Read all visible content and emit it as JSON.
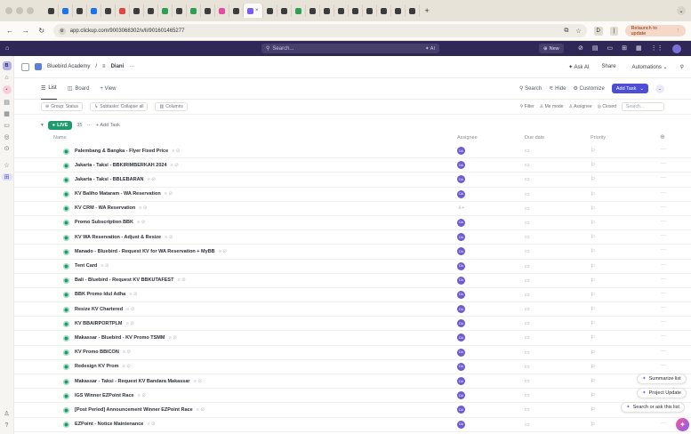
{
  "browser": {
    "tab_count": 26,
    "active_tab_close": "×",
    "new_tab": "+",
    "url": "app.clickup.com/9003068302/v/li/901601465277",
    "relaunch_label": "Relaunch to update"
  },
  "cu_header": {
    "search_placeholder": "Search...",
    "ai_label": "AI",
    "new_label": "New"
  },
  "breadcrumb": {
    "workspace": "Bluebird Academy",
    "separator": "/",
    "list": "Diani",
    "more": "···",
    "ask_ai": "Ask AI",
    "share": "Share",
    "automations": "Automations"
  },
  "views": {
    "list": "List",
    "board": "Board",
    "add_view": "+ View",
    "search": "Search",
    "hide": "Hide",
    "customize": "Customize",
    "add_task": "Add Task"
  },
  "filters": {
    "group": "Group: Status",
    "subtasks": "Subtasks: Collapse all",
    "columns": "Columns",
    "filter": "Filter",
    "me_mode": "Me mode",
    "assignee": "Assignee",
    "closed": "Closed",
    "search_placeholder": "Search..."
  },
  "group": {
    "status": "LIVE",
    "count": "35",
    "more": "···",
    "add_task": "+ Add Task"
  },
  "columns": {
    "name": "Name",
    "assignee": "Assignee",
    "due_date": "Due date",
    "priority": "Priority"
  },
  "tasks": [
    {
      "name": "Palembang & Bangka - Flyer Fixed Price",
      "assignee": "DA"
    },
    {
      "name": "Jakarta - Taksi - BBKIRIMBERKAH 2024",
      "assignee": "DA"
    },
    {
      "name": "Jakarta - Taksi - BBLEBARAN",
      "assignee": "DA"
    },
    {
      "name": "KV Baliho Mataram - WA Reservation",
      "assignee": "DA"
    },
    {
      "name": "KV CRM - WA Reservation",
      "assignee": ""
    },
    {
      "name": "Promo Subscription BBK",
      "assignee": "DA"
    },
    {
      "name": "KV WA Reservation - Adjust & Resize",
      "assignee": "DA"
    },
    {
      "name": "Manado - Bluebird - Request KV for WA Reservation + MyBB",
      "assignee": "DA"
    },
    {
      "name": "Tent Card",
      "assignee": "DA"
    },
    {
      "name": "Bali - Bluebird - Request KV BBKUTAFEST",
      "assignee": "DA"
    },
    {
      "name": "BBK Promo Idul Adha",
      "assignee": "DA"
    },
    {
      "name": "Resize KV Chartered",
      "assignee": "DA"
    },
    {
      "name": "KV BBAIRPORTPLM",
      "assignee": "DA"
    },
    {
      "name": "Makassar - Bluebird - KV Promo TSMM",
      "assignee": "DA"
    },
    {
      "name": "KV Promo BBICON",
      "assignee": "DA"
    },
    {
      "name": "Redesign KV Prom",
      "assignee": "DA"
    },
    {
      "name": "Makassar - Taksi - Request KV Bandara Makassar",
      "assignee": "DA"
    },
    {
      "name": "IGS Winner EZPoint Race",
      "assignee": "DA"
    },
    {
      "name": "[Post Period] Announcement Winner EZPoint Race",
      "assignee": "DA"
    },
    {
      "name": "EZPoint - Notice Maintenance",
      "assignee": "DA"
    }
  ],
  "ai_actions": {
    "summarize": "Summarize list",
    "project_update": "Project Update",
    "search_ask": "Search or ask this list"
  },
  "colors": {
    "brand_header": "#2f2856",
    "live_status": "#1f9a6d",
    "accent": "#4c4fd6",
    "assignee": "#6c5ccf"
  }
}
